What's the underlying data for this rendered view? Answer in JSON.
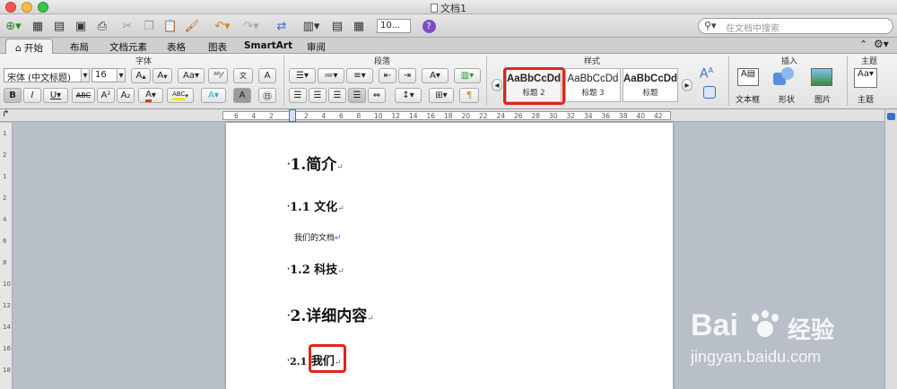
{
  "window": {
    "title": "文档1"
  },
  "toolbar": {
    "zoom_value": "10...",
    "search_placeholder": "在文档中搜索"
  },
  "tabs": [
    "开始",
    "布局",
    "文档元素",
    "表格",
    "图表",
    "SmartArt",
    "审阅"
  ],
  "ribbon": {
    "font_group_label": "字体",
    "paragraph_group_label": "段落",
    "styles_group_label": "样式",
    "insert_group_label": "插入",
    "theme_group_label": "主题",
    "font_name": "宋体 (中文标题)",
    "font_size": "16",
    "styles": [
      {
        "sample": "AaBbCcDd",
        "name": "标题 2"
      },
      {
        "sample": "AaBbCcDd",
        "name": "标题 3"
      },
      {
        "sample": "AaBbCcDd",
        "name": "标题"
      }
    ],
    "insert_items": [
      "文本框",
      "形状",
      "图片"
    ],
    "theme_item": "主题"
  },
  "ruler": {
    "ticks": [
      "6",
      "4",
      "2",
      "",
      "2",
      "4",
      "6",
      "8",
      "10",
      "12",
      "14",
      "16",
      "18",
      "20",
      "22",
      "24",
      "26",
      "28",
      "30",
      "32",
      "34",
      "36",
      "38",
      "40",
      "42"
    ]
  },
  "vruler": {
    "ticks": [
      "1",
      "2",
      "1",
      "2",
      "4",
      "6",
      "8",
      "10",
      "12",
      "14",
      "16",
      "18"
    ]
  },
  "document": {
    "h1_a": "1.简介",
    "h2_a": "1.1 文化",
    "body_a": "我们的文档",
    "h2_b": "1.2 科技",
    "h1_b": "2.详细内容",
    "h2_c_num": "2.1",
    "h2_c_text": "我们"
  },
  "watermark": {
    "brand": "Bai",
    "brand_cn": "经验",
    "url": "jingyan.baidu.com"
  },
  "colors": {
    "highlight": "#e0241c",
    "accent_blue": "#3a6fd0"
  }
}
